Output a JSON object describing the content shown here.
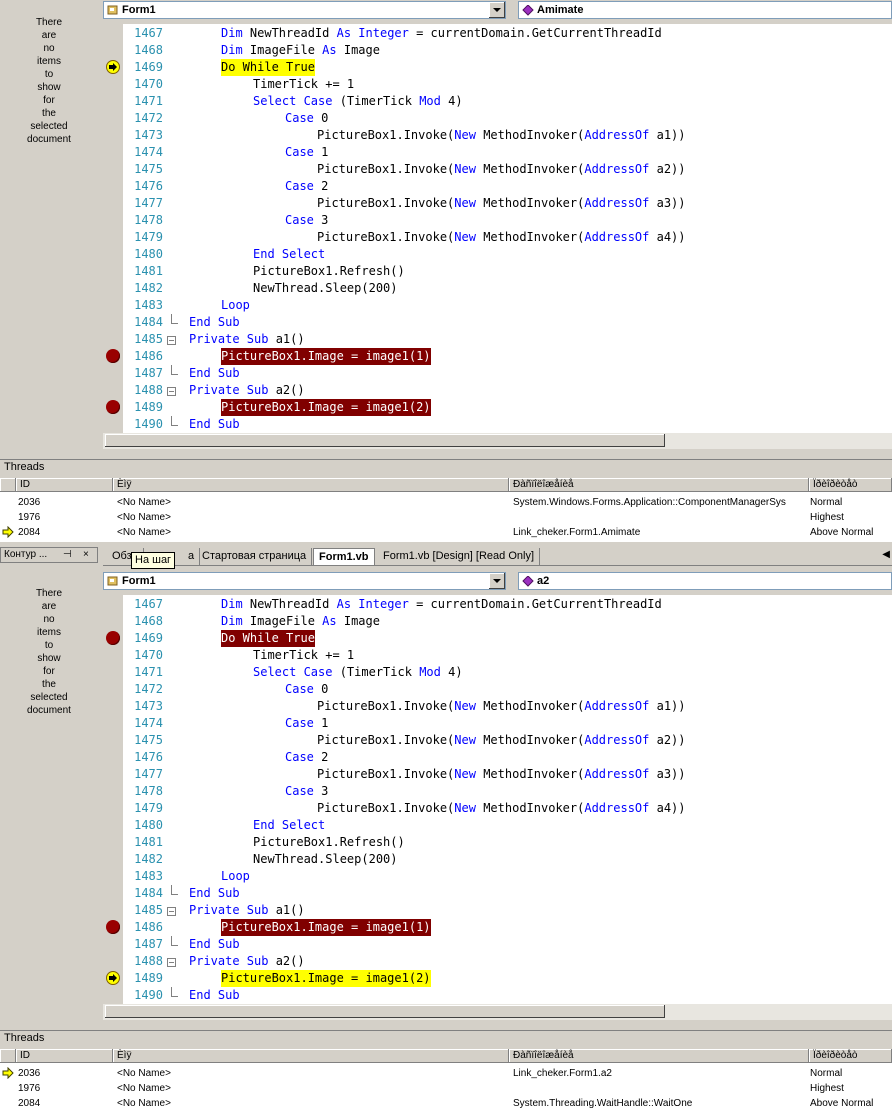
{
  "left_panel": {
    "message_lines": [
      "There",
      "are",
      "no",
      "items",
      "to",
      "show",
      "for",
      "the",
      "selected",
      "document"
    ]
  },
  "top_editor": {
    "class_combo": "Form1",
    "method_combo": "Amimate",
    "lines": [
      {
        "num": "1467",
        "indent": 0,
        "parts": [
          {
            "t": "Dim",
            "k": 1
          },
          {
            "t": " NewThreadId "
          },
          {
            "t": "As",
            "k": 1
          },
          {
            "t": " "
          },
          {
            "t": "Integer",
            "k": 1
          },
          {
            "t": " = currentDomain.GetCurrentThreadId"
          }
        ],
        "marker": "",
        "hl": ""
      },
      {
        "num": "1468",
        "indent": 0,
        "parts": [
          {
            "t": "Dim",
            "k": 1
          },
          {
            "t": " ImageFile "
          },
          {
            "t": "As",
            "k": 1
          },
          {
            "t": " Image"
          }
        ],
        "marker": "",
        "hl": ""
      },
      {
        "num": "1469",
        "indent": 0,
        "parts": [
          {
            "t": "Do While True"
          }
        ],
        "marker": "arrow",
        "hl": "yellow"
      },
      {
        "num": "1470",
        "indent": 1,
        "parts": [
          {
            "t": "TimerTick += 1"
          }
        ],
        "marker": "",
        "hl": ""
      },
      {
        "num": "1471",
        "indent": 1,
        "parts": [
          {
            "t": "Select Case",
            "k": 1
          },
          {
            "t": " (TimerTick "
          },
          {
            "t": "Mod",
            "k": 1
          },
          {
            "t": " 4)"
          }
        ],
        "marker": "",
        "hl": ""
      },
      {
        "num": "1472",
        "indent": 2,
        "parts": [
          {
            "t": "Case",
            "k": 1
          },
          {
            "t": " 0"
          }
        ],
        "marker": "",
        "hl": ""
      },
      {
        "num": "1473",
        "indent": 3,
        "parts": [
          {
            "t": "PictureBox1.Invoke("
          },
          {
            "t": "New",
            "k": 1
          },
          {
            "t": " MethodInvoker("
          },
          {
            "t": "AddressOf",
            "k": 1
          },
          {
            "t": " a1))"
          }
        ],
        "marker": "",
        "hl": ""
      },
      {
        "num": "1474",
        "indent": 2,
        "parts": [
          {
            "t": "Case",
            "k": 1
          },
          {
            "t": " 1"
          }
        ],
        "marker": "",
        "hl": ""
      },
      {
        "num": "1475",
        "indent": 3,
        "parts": [
          {
            "t": "PictureBox1.Invoke("
          },
          {
            "t": "New",
            "k": 1
          },
          {
            "t": " MethodInvoker("
          },
          {
            "t": "AddressOf",
            "k": 1
          },
          {
            "t": " a2))"
          }
        ],
        "marker": "",
        "hl": ""
      },
      {
        "num": "1476",
        "indent": 2,
        "parts": [
          {
            "t": "Case",
            "k": 1
          },
          {
            "t": " 2"
          }
        ],
        "marker": "",
        "hl": ""
      },
      {
        "num": "1477",
        "indent": 3,
        "parts": [
          {
            "t": "PictureBox1.Invoke("
          },
          {
            "t": "New",
            "k": 1
          },
          {
            "t": " MethodInvoker("
          },
          {
            "t": "AddressOf",
            "k": 1
          },
          {
            "t": " a3))"
          }
        ],
        "marker": "",
        "hl": ""
      },
      {
        "num": "1478",
        "indent": 2,
        "parts": [
          {
            "t": "Case",
            "k": 1
          },
          {
            "t": " 3"
          }
        ],
        "marker": "",
        "hl": ""
      },
      {
        "num": "1479",
        "indent": 3,
        "parts": [
          {
            "t": "PictureBox1.Invoke("
          },
          {
            "t": "New",
            "k": 1
          },
          {
            "t": " MethodInvoker("
          },
          {
            "t": "AddressOf",
            "k": 1
          },
          {
            "t": " a4))"
          }
        ],
        "marker": "",
        "hl": ""
      },
      {
        "num": "1480",
        "indent": 1,
        "parts": [
          {
            "t": "End Select",
            "k": 1
          }
        ],
        "marker": "",
        "hl": ""
      },
      {
        "num": "1481",
        "indent": 1,
        "parts": [
          {
            "t": "PictureBox1.Refresh()"
          }
        ],
        "marker": "",
        "hl": ""
      },
      {
        "num": "1482",
        "indent": 1,
        "parts": [
          {
            "t": "NewThread.Sleep(200)"
          }
        ],
        "marker": "",
        "hl": ""
      },
      {
        "num": "1483",
        "indent": 0,
        "parts": [
          {
            "t": "Loop",
            "k": 1
          }
        ],
        "marker": "",
        "hl": ""
      },
      {
        "num": "1484",
        "indent": -1,
        "parts": [
          {
            "t": "End Sub",
            "k": 1
          }
        ],
        "marker": "",
        "hl": "",
        "fold": "end"
      },
      {
        "num": "1485",
        "indent": -1,
        "parts": [
          {
            "t": "Private Sub",
            "k": 1
          },
          {
            "t": " a1()"
          }
        ],
        "marker": "",
        "hl": "",
        "fold": "start"
      },
      {
        "num": "1486",
        "indent": 0,
        "parts": [
          {
            "t": "PictureBox1.Image = image1(1)"
          }
        ],
        "marker": "bp",
        "hl": "bp"
      },
      {
        "num": "1487",
        "indent": -1,
        "parts": [
          {
            "t": "End Sub",
            "k": 1
          }
        ],
        "marker": "",
        "hl": "",
        "fold": "end"
      },
      {
        "num": "1488",
        "indent": -1,
        "parts": [
          {
            "t": "Private Sub",
            "k": 1
          },
          {
            "t": " a2()"
          }
        ],
        "marker": "",
        "hl": "",
        "fold": "start"
      },
      {
        "num": "1489",
        "indent": 0,
        "parts": [
          {
            "t": "PictureBox1.Image = image1(2)"
          }
        ],
        "marker": "bp",
        "hl": "bp"
      },
      {
        "num": "1490",
        "indent": -1,
        "parts": [
          {
            "t": "End Sub",
            "k": 1
          }
        ],
        "marker": "",
        "hl": "",
        "fold": "end"
      }
    ]
  },
  "top_threads": {
    "title": "Threads",
    "columns": [
      "ID",
      "Èìÿ",
      "Ðàñïîëîæåíèå",
      "Ïðèîðèòåò"
    ],
    "rows": [
      {
        "id": "2036",
        "name": "<No Name>",
        "location": "System.Windows.Forms.Application::ComponentManagerSys",
        "priority": "Normal",
        "current": false
      },
      {
        "id": "1976",
        "name": "<No Name>",
        "location": "",
        "priority": "Highest",
        "current": false
      },
      {
        "id": "2084",
        "name": "<No Name>",
        "location": "Link_cheker.Form1.Amimate",
        "priority": "Above Normal",
        "current": true
      }
    ]
  },
  "middle": {
    "outline_pane_title": "Контур ...",
    "tabs": [
      "Обзо",
      "а",
      "Стартовая страница",
      "Form1.vb",
      "Form1.vb [Design] [Read Only]"
    ],
    "tooltip": "На шаг"
  },
  "bottom_editor": {
    "class_combo": "Form1",
    "method_combo": "a2",
    "lines": [
      {
        "num": "1467",
        "indent": 0,
        "parts": [
          {
            "t": "Dim",
            "k": 1
          },
          {
            "t": " NewThreadId "
          },
          {
            "t": "As",
            "k": 1
          },
          {
            "t": " "
          },
          {
            "t": "Integer",
            "k": 1
          },
          {
            "t": " = currentDomain.GetCurrentThreadId"
          }
        ],
        "marker": "",
        "hl": ""
      },
      {
        "num": "1468",
        "indent": 0,
        "parts": [
          {
            "t": "Dim",
            "k": 1
          },
          {
            "t": " ImageFile "
          },
          {
            "t": "As",
            "k": 1
          },
          {
            "t": " Image"
          }
        ],
        "marker": "",
        "hl": ""
      },
      {
        "num": "1469",
        "indent": 0,
        "parts": [
          {
            "t": "Do While True"
          }
        ],
        "marker": "bp",
        "hl": "bp"
      },
      {
        "num": "1470",
        "indent": 1,
        "parts": [
          {
            "t": "TimerTick += 1"
          }
        ],
        "marker": "",
        "hl": ""
      },
      {
        "num": "1471",
        "indent": 1,
        "parts": [
          {
            "t": "Select Case",
            "k": 1
          },
          {
            "t": " (TimerTick "
          },
          {
            "t": "Mod",
            "k": 1
          },
          {
            "t": " 4)"
          }
        ],
        "marker": "",
        "hl": ""
      },
      {
        "num": "1472",
        "indent": 2,
        "parts": [
          {
            "t": "Case",
            "k": 1
          },
          {
            "t": " 0"
          }
        ],
        "marker": "",
        "hl": ""
      },
      {
        "num": "1473",
        "indent": 3,
        "parts": [
          {
            "t": "PictureBox1.Invoke("
          },
          {
            "t": "New",
            "k": 1
          },
          {
            "t": " MethodInvoker("
          },
          {
            "t": "AddressOf",
            "k": 1
          },
          {
            "t": " a1))"
          }
        ],
        "marker": "",
        "hl": ""
      },
      {
        "num": "1474",
        "indent": 2,
        "parts": [
          {
            "t": "Case",
            "k": 1
          },
          {
            "t": " 1"
          }
        ],
        "marker": "",
        "hl": ""
      },
      {
        "num": "1475",
        "indent": 3,
        "parts": [
          {
            "t": "PictureBox1.Invoke("
          },
          {
            "t": "New",
            "k": 1
          },
          {
            "t": " MethodInvoker("
          },
          {
            "t": "AddressOf",
            "k": 1
          },
          {
            "t": " a2))"
          }
        ],
        "marker": "",
        "hl": ""
      },
      {
        "num": "1476",
        "indent": 2,
        "parts": [
          {
            "t": "Case",
            "k": 1
          },
          {
            "t": " 2"
          }
        ],
        "marker": "",
        "hl": ""
      },
      {
        "num": "1477",
        "indent": 3,
        "parts": [
          {
            "t": "PictureBox1.Invoke("
          },
          {
            "t": "New",
            "k": 1
          },
          {
            "t": " MethodInvoker("
          },
          {
            "t": "AddressOf",
            "k": 1
          },
          {
            "t": " a3))"
          }
        ],
        "marker": "",
        "hl": ""
      },
      {
        "num": "1478",
        "indent": 2,
        "parts": [
          {
            "t": "Case",
            "k": 1
          },
          {
            "t": " 3"
          }
        ],
        "marker": "",
        "hl": ""
      },
      {
        "num": "1479",
        "indent": 3,
        "parts": [
          {
            "t": "PictureBox1.Invoke("
          },
          {
            "t": "New",
            "k": 1
          },
          {
            "t": " MethodInvoker("
          },
          {
            "t": "AddressOf",
            "k": 1
          },
          {
            "t": " a4))"
          }
        ],
        "marker": "",
        "hl": ""
      },
      {
        "num": "1480",
        "indent": 1,
        "parts": [
          {
            "t": "End Select",
            "k": 1
          }
        ],
        "marker": "",
        "hl": ""
      },
      {
        "num": "1481",
        "indent": 1,
        "parts": [
          {
            "t": "PictureBox1.Refresh()"
          }
        ],
        "marker": "",
        "hl": ""
      },
      {
        "num": "1482",
        "indent": 1,
        "parts": [
          {
            "t": "NewThread.Sleep(200)"
          }
        ],
        "marker": "",
        "hl": ""
      },
      {
        "num": "1483",
        "indent": 0,
        "parts": [
          {
            "t": "Loop",
            "k": 1
          }
        ],
        "marker": "",
        "hl": ""
      },
      {
        "num": "1484",
        "indent": -1,
        "parts": [
          {
            "t": "End Sub",
            "k": 1
          }
        ],
        "marker": "",
        "hl": "",
        "fold": "end"
      },
      {
        "num": "1485",
        "indent": -1,
        "parts": [
          {
            "t": "Private Sub",
            "k": 1
          },
          {
            "t": " a1()"
          }
        ],
        "marker": "",
        "hl": "",
        "fold": "start"
      },
      {
        "num": "1486",
        "indent": 0,
        "parts": [
          {
            "t": "PictureBox1.Image = image1(1)"
          }
        ],
        "marker": "bp",
        "hl": "bp"
      },
      {
        "num": "1487",
        "indent": -1,
        "parts": [
          {
            "t": "End Sub",
            "k": 1
          }
        ],
        "marker": "",
        "hl": "",
        "fold": "end"
      },
      {
        "num": "1488",
        "indent": -1,
        "parts": [
          {
            "t": "Private Sub",
            "k": 1
          },
          {
            "t": " a2()"
          }
        ],
        "marker": "",
        "hl": "",
        "fold": "start"
      },
      {
        "num": "1489",
        "indent": 0,
        "parts": [
          {
            "t": "PictureBox1.Image = image1(2)"
          }
        ],
        "marker": "arrow",
        "hl": "yellow"
      },
      {
        "num": "1490",
        "indent": -1,
        "parts": [
          {
            "t": "End Sub",
            "k": 1
          }
        ],
        "marker": "",
        "hl": "",
        "fold": "end"
      }
    ]
  },
  "bottom_threads": {
    "title": "Threads",
    "columns": [
      "ID",
      "Èìÿ",
      "Ðàñïîëîæåíèå",
      "Ïðèîðèòåò"
    ],
    "rows": [
      {
        "id": "2036",
        "name": "<No Name>",
        "location": "Link_cheker.Form1.a2",
        "priority": "Normal",
        "current": true
      },
      {
        "id": "1976",
        "name": "<No Name>",
        "location": "",
        "priority": "Highest",
        "current": false
      },
      {
        "id": "2084",
        "name": "<No Name>",
        "location": "System.Threading.WaitHandle::WaitOne",
        "priority": "Above Normal",
        "current": false
      }
    ]
  },
  "colors": {
    "keyword": "#0000ff",
    "line_number": "#2b91af",
    "breakpoint": "#800000",
    "current_statement": "#ffff00"
  }
}
